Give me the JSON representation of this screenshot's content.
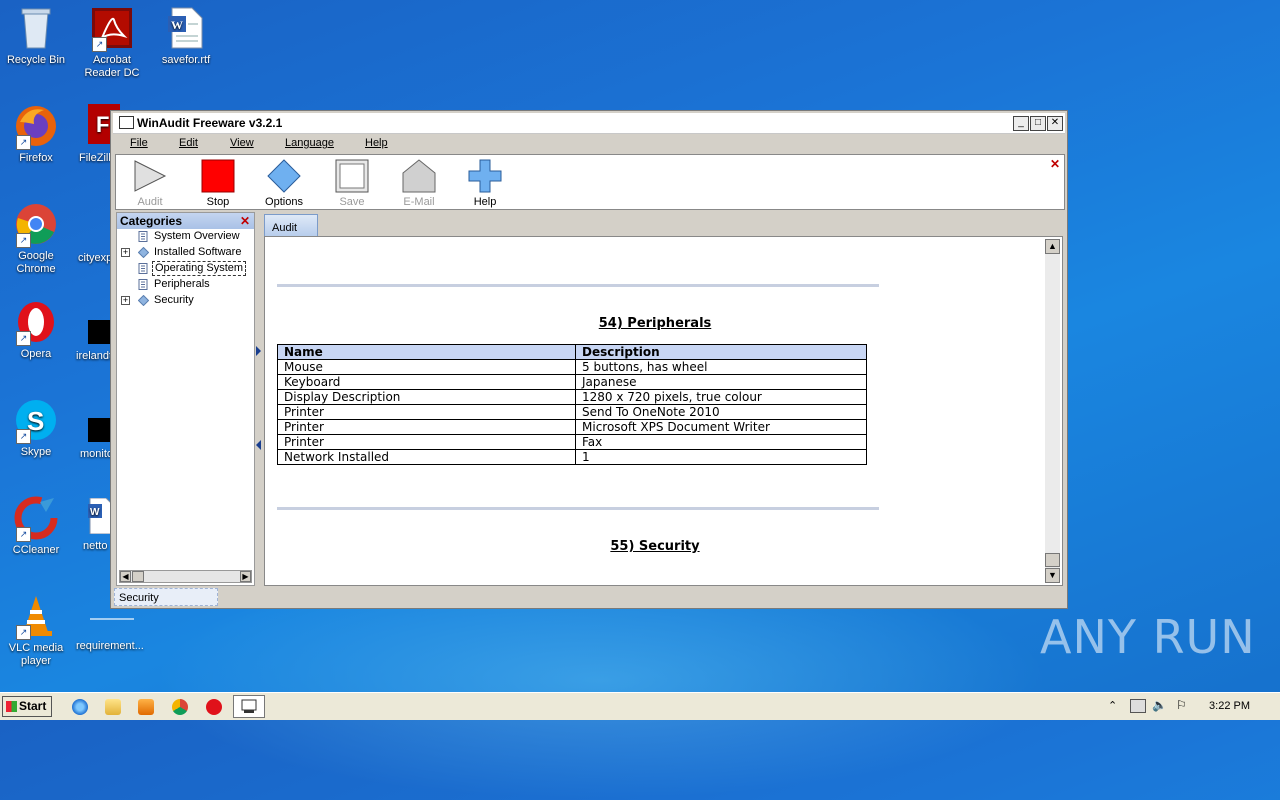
{
  "desktop": {
    "icons": [
      {
        "label": "Recycle Bin"
      },
      {
        "label": "Acrobat Reader DC"
      },
      {
        "label": "savefor.rtf"
      },
      {
        "label": "Firefox"
      },
      {
        "label": "FileZilla"
      },
      {
        "label": "Google Chrome"
      },
      {
        "label": "cityexp"
      },
      {
        "label": "Opera"
      },
      {
        "label": "irelandt"
      },
      {
        "label": "Skype"
      },
      {
        "label": "monito"
      },
      {
        "label": "CCleaner"
      },
      {
        "label": "netto"
      },
      {
        "label": "VLC media player"
      },
      {
        "label": "requirement..."
      }
    ],
    "watermark": "ANY RUN"
  },
  "window": {
    "title": "WinAudit Freeware v3.2.1",
    "menu": [
      "File",
      "Edit",
      "View",
      "Language",
      "Help"
    ],
    "toolbar": [
      {
        "label": "Audit",
        "icon": "play-icon",
        "enabled": false
      },
      {
        "label": "Stop",
        "icon": "stop-icon",
        "enabled": true
      },
      {
        "label": "Options",
        "icon": "diamond-icon",
        "enabled": true
      },
      {
        "label": "Save",
        "icon": "save-icon",
        "enabled": false
      },
      {
        "label": "E-Mail",
        "icon": "house-icon",
        "enabled": false
      },
      {
        "label": "Help",
        "icon": "plus-icon",
        "enabled": true
      }
    ],
    "categories": {
      "header": "Categories",
      "items": [
        {
          "label": "System Overview",
          "expandable": false
        },
        {
          "label": "Installed Software",
          "expandable": true
        },
        {
          "label": "Operating System",
          "expandable": false,
          "selected": true
        },
        {
          "label": "Peripherals",
          "expandable": false
        },
        {
          "label": "Security",
          "expandable": true
        }
      ]
    },
    "tab": "Audit",
    "report": {
      "section1_title": "54) Peripherals",
      "columns": [
        "Name",
        "Description"
      ],
      "rows": [
        [
          "Mouse",
          "5 buttons, has wheel"
        ],
        [
          "Keyboard",
          "Japanese"
        ],
        [
          "Display Description",
          "1280 x 720 pixels, true colour"
        ],
        [
          "Printer",
          "Send To OneNote 2010"
        ],
        [
          "Printer",
          "Microsoft XPS Document Writer"
        ],
        [
          "Printer",
          "Fax"
        ],
        [
          "Network Installed",
          "1"
        ]
      ],
      "section2_title": "55) Security"
    },
    "status": "Security"
  },
  "taskbar": {
    "start": "Start",
    "clock": "3:22 PM"
  },
  "colors": {
    "desktop": "#1a74d6",
    "stop": "#ff0000",
    "options": "#6fb0f0",
    "table_header": "#c8d6f4"
  }
}
